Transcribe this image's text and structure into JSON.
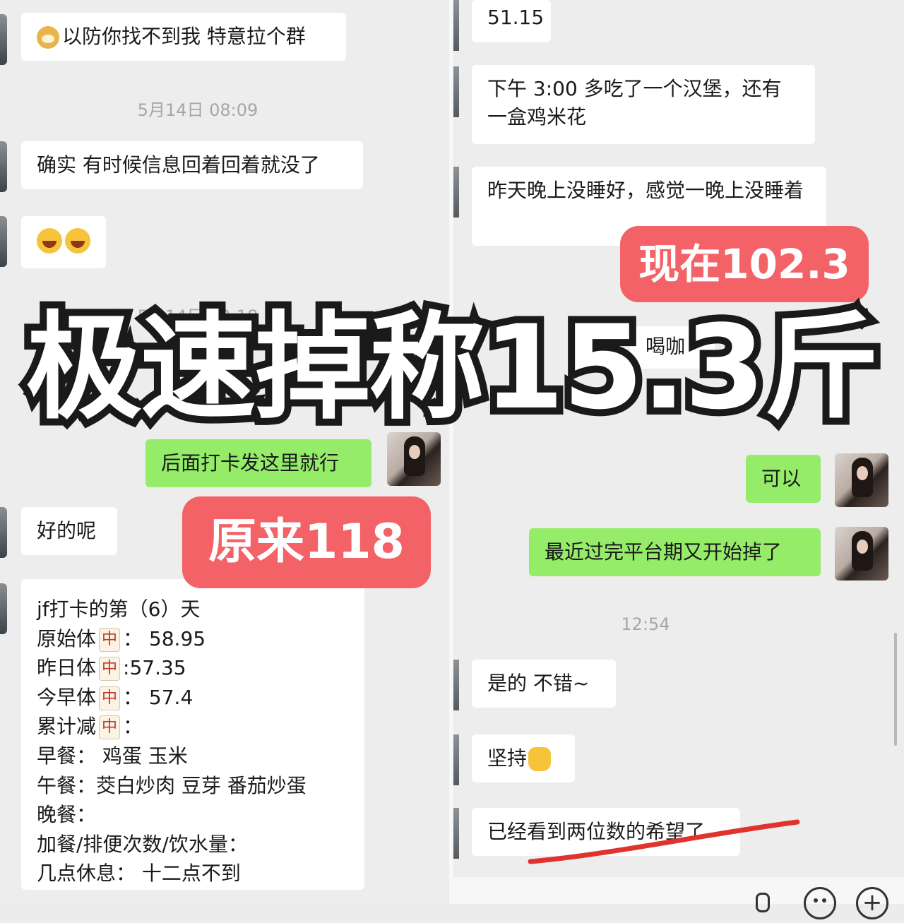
{
  "left": {
    "msg_group": "以防你找不到我 特意拉个群",
    "ts1": "5月14日 08:09",
    "msg_confirm": "确实 有时候信息回着回着就没了",
    "ts2": "5月14日 12:18",
    "msg_sent": "后面打卡发这里就行",
    "msg_ok": "好的呢",
    "log": {
      "line1": "jf打卡的第（6）天",
      "line2_pre": "原始体",
      "line2_post": "：  58.95",
      "line3_pre": "昨日体",
      "line3_post": ":57.35",
      "line4_pre": "今早体",
      "line4_post": "：  57.4",
      "line5_pre": "累计减",
      "line5_post": "：",
      "line6": "早餐：  鸡蛋 玉米",
      "line7": "午餐：茭白炒肉 豆芽 番茄炒蛋",
      "line8": "晚餐：",
      "line9": "加餐/排便次数/饮水量：",
      "line10": "几点休息：  十二点不到",
      "tile_char": "中"
    }
  },
  "right": {
    "msg_weight": "51.15",
    "msg_burger": "下午 3:00 多吃了一个汉堡，还有一盒鸡米花",
    "msg_sleep": "昨天晚上没睡好，感觉一晚上没睡着",
    "msg_coffee_partial": "喝咖",
    "msg_ok": "可以",
    "msg_plateau": "最近过完平台期又开始掉了",
    "ts": "12:54",
    "msg_yes": "是的 不错~",
    "msg_keep": "坚持",
    "msg_hope": "已经看到两位数的希望了"
  },
  "overlay": {
    "headline": "极速掉称15.3斤",
    "now_label": "现在102.3",
    "orig_label": "原来118",
    "accent_red": "#f26266",
    "underline_red": "#e0332f"
  },
  "toolbar": {
    "add_icon": "+"
  }
}
